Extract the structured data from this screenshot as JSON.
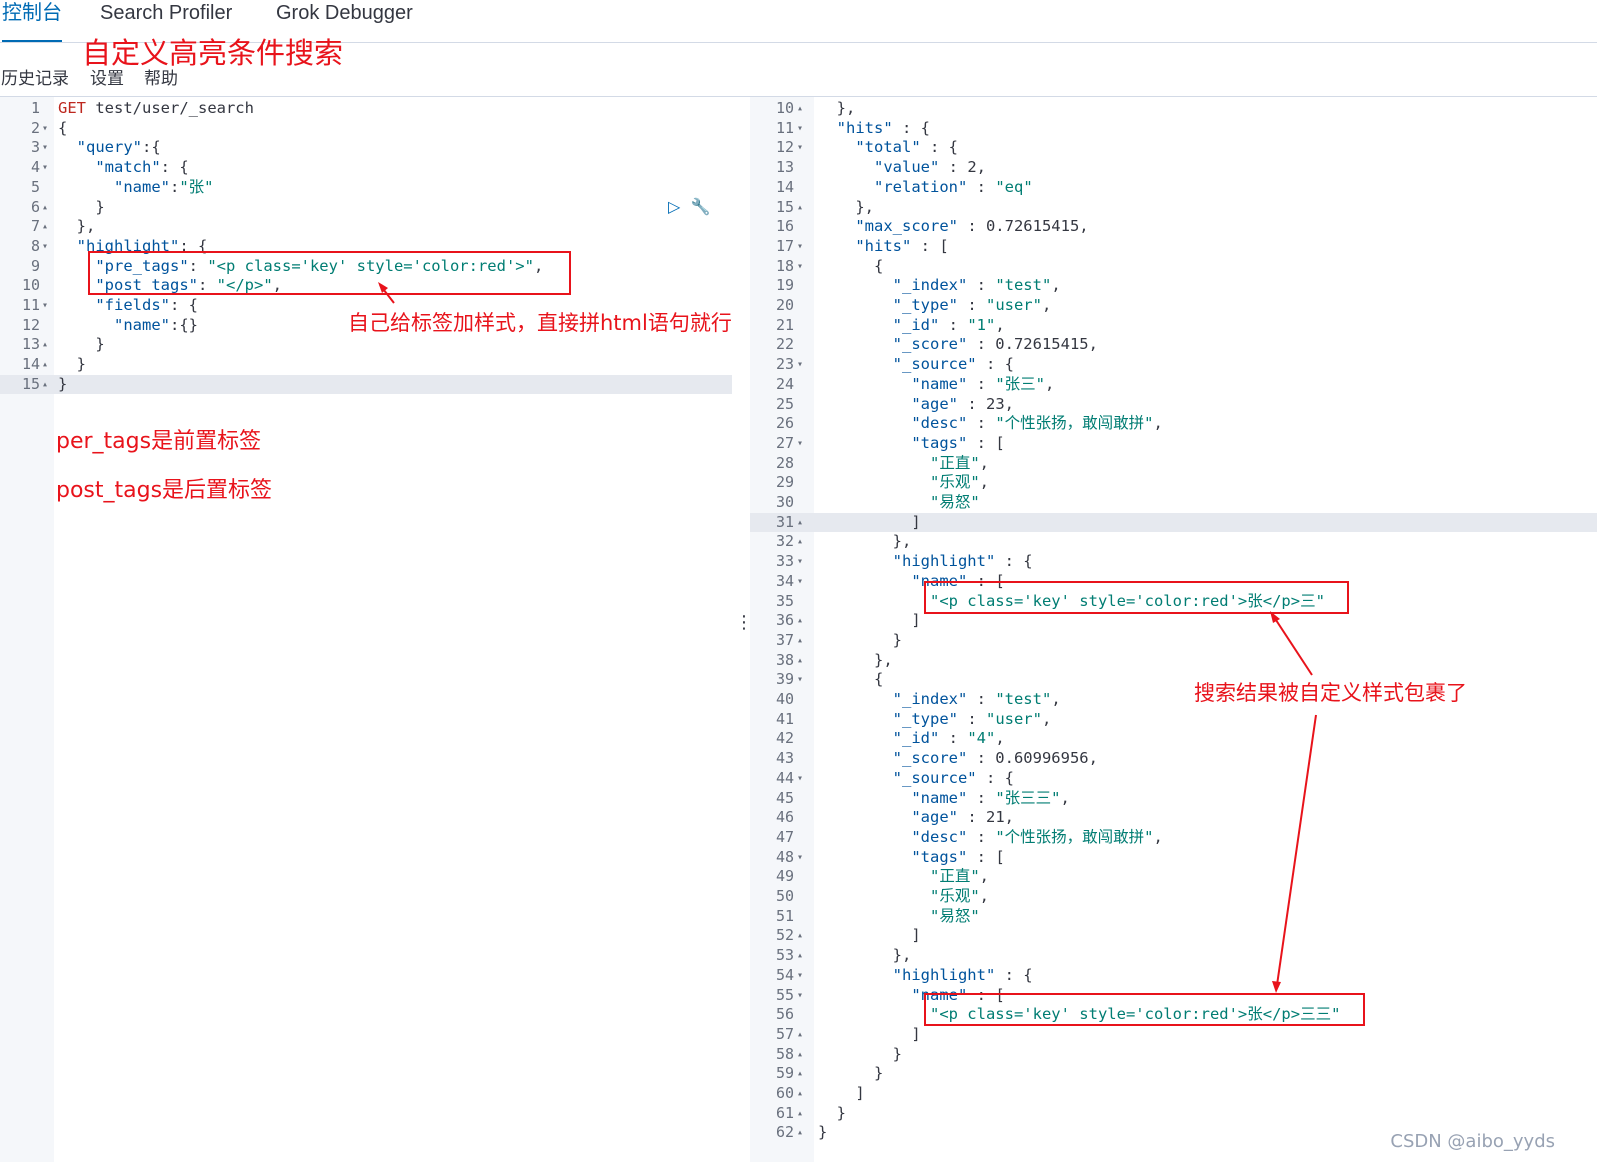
{
  "tabs": [
    "控制台",
    "Search Profiler",
    "Grok Debugger"
  ],
  "toolbar": [
    "历史记录",
    "设置",
    "帮助"
  ],
  "annotations": {
    "title": "自定义高亮条件搜索",
    "pretags_note": "自己给标签加样式，直接拼html语句就行",
    "per_tags": "per_tags是前置标签",
    "post_tags": "post_tags是后置标签",
    "result_note": "搜索结果被自定义样式包裹了"
  },
  "request": {
    "method": "GET",
    "path": "test/user/_search"
  },
  "left_lines": [
    {
      "n": "1",
      "f": "",
      "c": "GET test/user/_search"
    },
    {
      "n": "2",
      "f": "▾",
      "c": "{"
    },
    {
      "n": "3",
      "f": "▾",
      "c": "  \"query\":{"
    },
    {
      "n": "4",
      "f": "▾",
      "c": "    \"match\": {"
    },
    {
      "n": "5",
      "f": "",
      "c": "      \"name\":\"张\""
    },
    {
      "n": "6",
      "f": "▴",
      "c": "    }"
    },
    {
      "n": "7",
      "f": "▴",
      "c": "  },"
    },
    {
      "n": "8",
      "f": "▾",
      "c": "  \"highlight\": {"
    },
    {
      "n": "9",
      "f": "",
      "c": "    \"pre_tags\": \"<p class='key' style='color:red'>\","
    },
    {
      "n": "10",
      "f": "",
      "c": "    \"post_tags\": \"</p>\","
    },
    {
      "n": "11",
      "f": "▾",
      "c": "    \"fields\": {"
    },
    {
      "n": "12",
      "f": "",
      "c": "      \"name\":{}"
    },
    {
      "n": "13",
      "f": "▴",
      "c": "    }"
    },
    {
      "n": "14",
      "f": "▴",
      "c": "  }"
    },
    {
      "n": "15",
      "f": "▴",
      "c": "}"
    }
  ],
  "right_lines": [
    {
      "n": "10",
      "f": "▴",
      "c": "  },"
    },
    {
      "n": "11",
      "f": "▾",
      "c": "  \"hits\" : {"
    },
    {
      "n": "12",
      "f": "▾",
      "c": "    \"total\" : {"
    },
    {
      "n": "13",
      "f": "",
      "c": "      \"value\" : 2,"
    },
    {
      "n": "14",
      "f": "",
      "c": "      \"relation\" : \"eq\""
    },
    {
      "n": "15",
      "f": "▴",
      "c": "    },"
    },
    {
      "n": "16",
      "f": "",
      "c": "    \"max_score\" : 0.72615415,"
    },
    {
      "n": "17",
      "f": "▾",
      "c": "    \"hits\" : ["
    },
    {
      "n": "18",
      "f": "▾",
      "c": "      {"
    },
    {
      "n": "19",
      "f": "",
      "c": "        \"_index\" : \"test\","
    },
    {
      "n": "20",
      "f": "",
      "c": "        \"_type\" : \"user\","
    },
    {
      "n": "21",
      "f": "",
      "c": "        \"_id\" : \"1\","
    },
    {
      "n": "22",
      "f": "",
      "c": "        \"_score\" : 0.72615415,"
    },
    {
      "n": "23",
      "f": "▾",
      "c": "        \"_source\" : {"
    },
    {
      "n": "24",
      "f": "",
      "c": "          \"name\" : \"张三\","
    },
    {
      "n": "25",
      "f": "",
      "c": "          \"age\" : 23,"
    },
    {
      "n": "26",
      "f": "",
      "c": "          \"desc\" : \"个性张扬，敢闯敢拼\","
    },
    {
      "n": "27",
      "f": "▾",
      "c": "          \"tags\" : ["
    },
    {
      "n": "28",
      "f": "",
      "c": "            \"正直\","
    },
    {
      "n": "29",
      "f": "",
      "c": "            \"乐观\","
    },
    {
      "n": "30",
      "f": "",
      "c": "            \"易怒\""
    },
    {
      "n": "31",
      "f": "▴",
      "c": "          ]"
    },
    {
      "n": "32",
      "f": "▴",
      "c": "        },"
    },
    {
      "n": "33",
      "f": "▾",
      "c": "        \"highlight\" : {"
    },
    {
      "n": "34",
      "f": "▾",
      "c": "          \"name\" : ["
    },
    {
      "n": "35",
      "f": "",
      "c": "            \"<p class='key' style='color:red'>张</p>三\""
    },
    {
      "n": "36",
      "f": "▴",
      "c": "          ]"
    },
    {
      "n": "37",
      "f": "▴",
      "c": "        }"
    },
    {
      "n": "38",
      "f": "▴",
      "c": "      },"
    },
    {
      "n": "39",
      "f": "▾",
      "c": "      {"
    },
    {
      "n": "40",
      "f": "",
      "c": "        \"_index\" : \"test\","
    },
    {
      "n": "41",
      "f": "",
      "c": "        \"_type\" : \"user\","
    },
    {
      "n": "42",
      "f": "",
      "c": "        \"_id\" : \"4\","
    },
    {
      "n": "43",
      "f": "",
      "c": "        \"_score\" : 0.60996956,"
    },
    {
      "n": "44",
      "f": "▾",
      "c": "        \"_source\" : {"
    },
    {
      "n": "45",
      "f": "",
      "c": "          \"name\" : \"张三三\","
    },
    {
      "n": "46",
      "f": "",
      "c": "          \"age\" : 21,"
    },
    {
      "n": "47",
      "f": "",
      "c": "          \"desc\" : \"个性张扬，敢闯敢拼\","
    },
    {
      "n": "48",
      "f": "▾",
      "c": "          \"tags\" : ["
    },
    {
      "n": "49",
      "f": "",
      "c": "            \"正直\","
    },
    {
      "n": "50",
      "f": "",
      "c": "            \"乐观\","
    },
    {
      "n": "51",
      "f": "",
      "c": "            \"易怒\""
    },
    {
      "n": "52",
      "f": "▴",
      "c": "          ]"
    },
    {
      "n": "53",
      "f": "▴",
      "c": "        },"
    },
    {
      "n": "54",
      "f": "▾",
      "c": "        \"highlight\" : {"
    },
    {
      "n": "55",
      "f": "▾",
      "c": "          \"name\" : ["
    },
    {
      "n": "56",
      "f": "",
      "c": "            \"<p class='key' style='color:red'>张</p>三三\""
    },
    {
      "n": "57",
      "f": "▴",
      "c": "          ]"
    },
    {
      "n": "58",
      "f": "▴",
      "c": "        }"
    },
    {
      "n": "59",
      "f": "▴",
      "c": "      }"
    },
    {
      "n": "60",
      "f": "▴",
      "c": "    ]"
    },
    {
      "n": "61",
      "f": "▴",
      "c": "  }"
    },
    {
      "n": "62",
      "f": "▴",
      "c": "}"
    }
  ],
  "watermark": "CSDN @aibo_yyds",
  "colors": {
    "accent": "#006bb4",
    "annotation": "#e8131b",
    "string": "#017d73",
    "key": "#00539c"
  }
}
